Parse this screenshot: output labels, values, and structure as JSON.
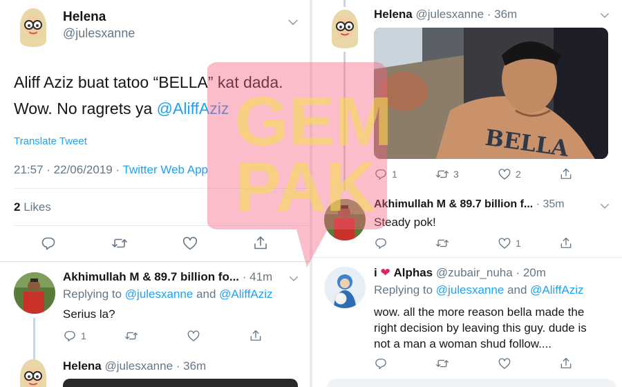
{
  "main_tweet": {
    "display_name": "Helena",
    "handle": "@julesxanne",
    "text_line1": "Aliff Aziz buat tatoo “BELLA” kat dada.",
    "text_line2_prefix": "Wow. No ragrets ya ",
    "mention": "@AliffAziz",
    "translate_label": "Translate Tweet",
    "timestamp": "21:57 · 22/06/2019 · ",
    "source": "Twitter Web App",
    "likes_count": "2",
    "likes_label": "Likes"
  },
  "reply_left": {
    "display_name": "Akhimullah M & 89.7 billion fo...",
    "time": "· 41m",
    "replying_prefix": "Replying to ",
    "replying_to_1": "@julesxanne",
    "replying_and": " and ",
    "replying_to_2": "@AliffAziz",
    "text": "Serius la?",
    "reply_count": "1"
  },
  "bottom_left": {
    "display_name": "Helena",
    "handle": "@julesxanne",
    "time": "· 36m"
  },
  "right_tweet": {
    "display_name": "Helena",
    "handle": "@julesxanne",
    "time": "· 36m",
    "reply_count": "1",
    "retweet_count": "3",
    "like_count": "2"
  },
  "right_reply_1": {
    "display_name": "Akhimullah M & 89.7 billion f...",
    "time": "· 35m",
    "text": "Steady pok!",
    "like_count": "1"
  },
  "right_reply_2": {
    "display_name_prefix": "i",
    "display_name_suffix": "Alphas",
    "handle": "@zubair_nuha",
    "time": "· 20m",
    "replying_prefix": "Replying to ",
    "replying_to_1": "@julesxanne",
    "replying_and": " and ",
    "replying_to_2": "@AliffAziz",
    "text_line1": "wow. all the more reason bella made the",
    "text_line2": "right decision by leaving this guy. dude is",
    "text_line3": "not a man a woman shud follow...."
  },
  "photo": {
    "tattoo_text": "BELLA"
  },
  "watermark": {
    "line1": "GEM",
    "line2": "PAK"
  },
  "colors": {
    "accent": "#1da1f2",
    "muted": "#657786",
    "watermark_pink": "#f2617e",
    "watermark_yellow": "#f6e04a",
    "heart": "#e0245e"
  },
  "icons": [
    "chevron-down-icon",
    "reply-icon",
    "retweet-icon",
    "like-icon",
    "share-icon",
    "heart-emoji-icon"
  ]
}
